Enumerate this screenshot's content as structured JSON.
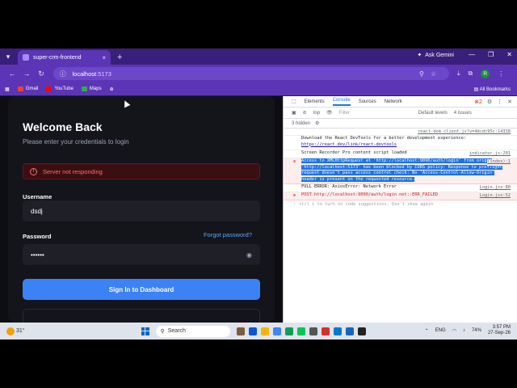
{
  "browser": {
    "tab_title": "super-crm-frontend",
    "tab_close": "×",
    "new_tab": "+",
    "ask_gemini": "Ask Gemini",
    "url_host": "localhost",
    "url_port": ":5173",
    "bookmarks": [
      {
        "label": "Gmail",
        "color": "#ea4335"
      },
      {
        "label": "YouTube",
        "color": "#ff0000"
      },
      {
        "label": "Maps",
        "color": "#34a853"
      }
    ],
    "all_bookmarks": "All Bookmarks",
    "avatar_letter": "R"
  },
  "login": {
    "title": "Welcome Back",
    "subtitle": "Please enter your credentials to login",
    "error_message": "Server not responding",
    "username_label": "Username",
    "username_value": "dsdj",
    "password_label": "Password",
    "forgot_password": "Forgot password?",
    "password_value": "••••••",
    "signin_button": "Sign In to Dashboard"
  },
  "devtools": {
    "tabs": [
      "Elements",
      "Console",
      "Sources",
      "Network"
    ],
    "active_tab": "Console",
    "context": "top",
    "filter_placeholder": "Filter",
    "levels": "Default levels",
    "issues": "4 issues",
    "error_count": "2",
    "hidden": "3 hidden",
    "logs": [
      {
        "kind": "info",
        "src": "react-dom_client.js?v=4dcdc95c:14338",
        "text": ""
      },
      {
        "kind": "info",
        "src": "",
        "text": "Download the React DevTools for a better development experience:",
        "link": "https://react.dev/link/react-devtools"
      },
      {
        "kind": "info",
        "src": "indicator.js:201",
        "text": "Screen Recorder Pro content script loaded"
      },
      {
        "kind": "err-selected",
        "src": "(index):1",
        "text": "Access to XMLHttpRequest at 'http://localhost:9090/auth/login' from origin 'http://localhost:5173' has been blocked by CORS policy: Response to preflight request doesn't pass access control check: No 'Access-Control-Allow-Origin' header is present on the requested resource."
      },
      {
        "kind": "info",
        "src": "Login.jsx:80",
        "text": "FULL ERROR: AxiosError: Network Error"
      },
      {
        "kind": "err",
        "src": "Login.jsx:52",
        "text": "POST http://localhost:9090/auth/login net::ERR_FAILED"
      }
    ],
    "prompt_hint": "ctrl i  to turn on code suggestions. Don't show again"
  },
  "taskbar": {
    "weather": "31°",
    "search_placeholder": "Search",
    "lang": "ENG",
    "battery": "74%",
    "time": "3:57 PM",
    "date": "27-Sep-26"
  }
}
